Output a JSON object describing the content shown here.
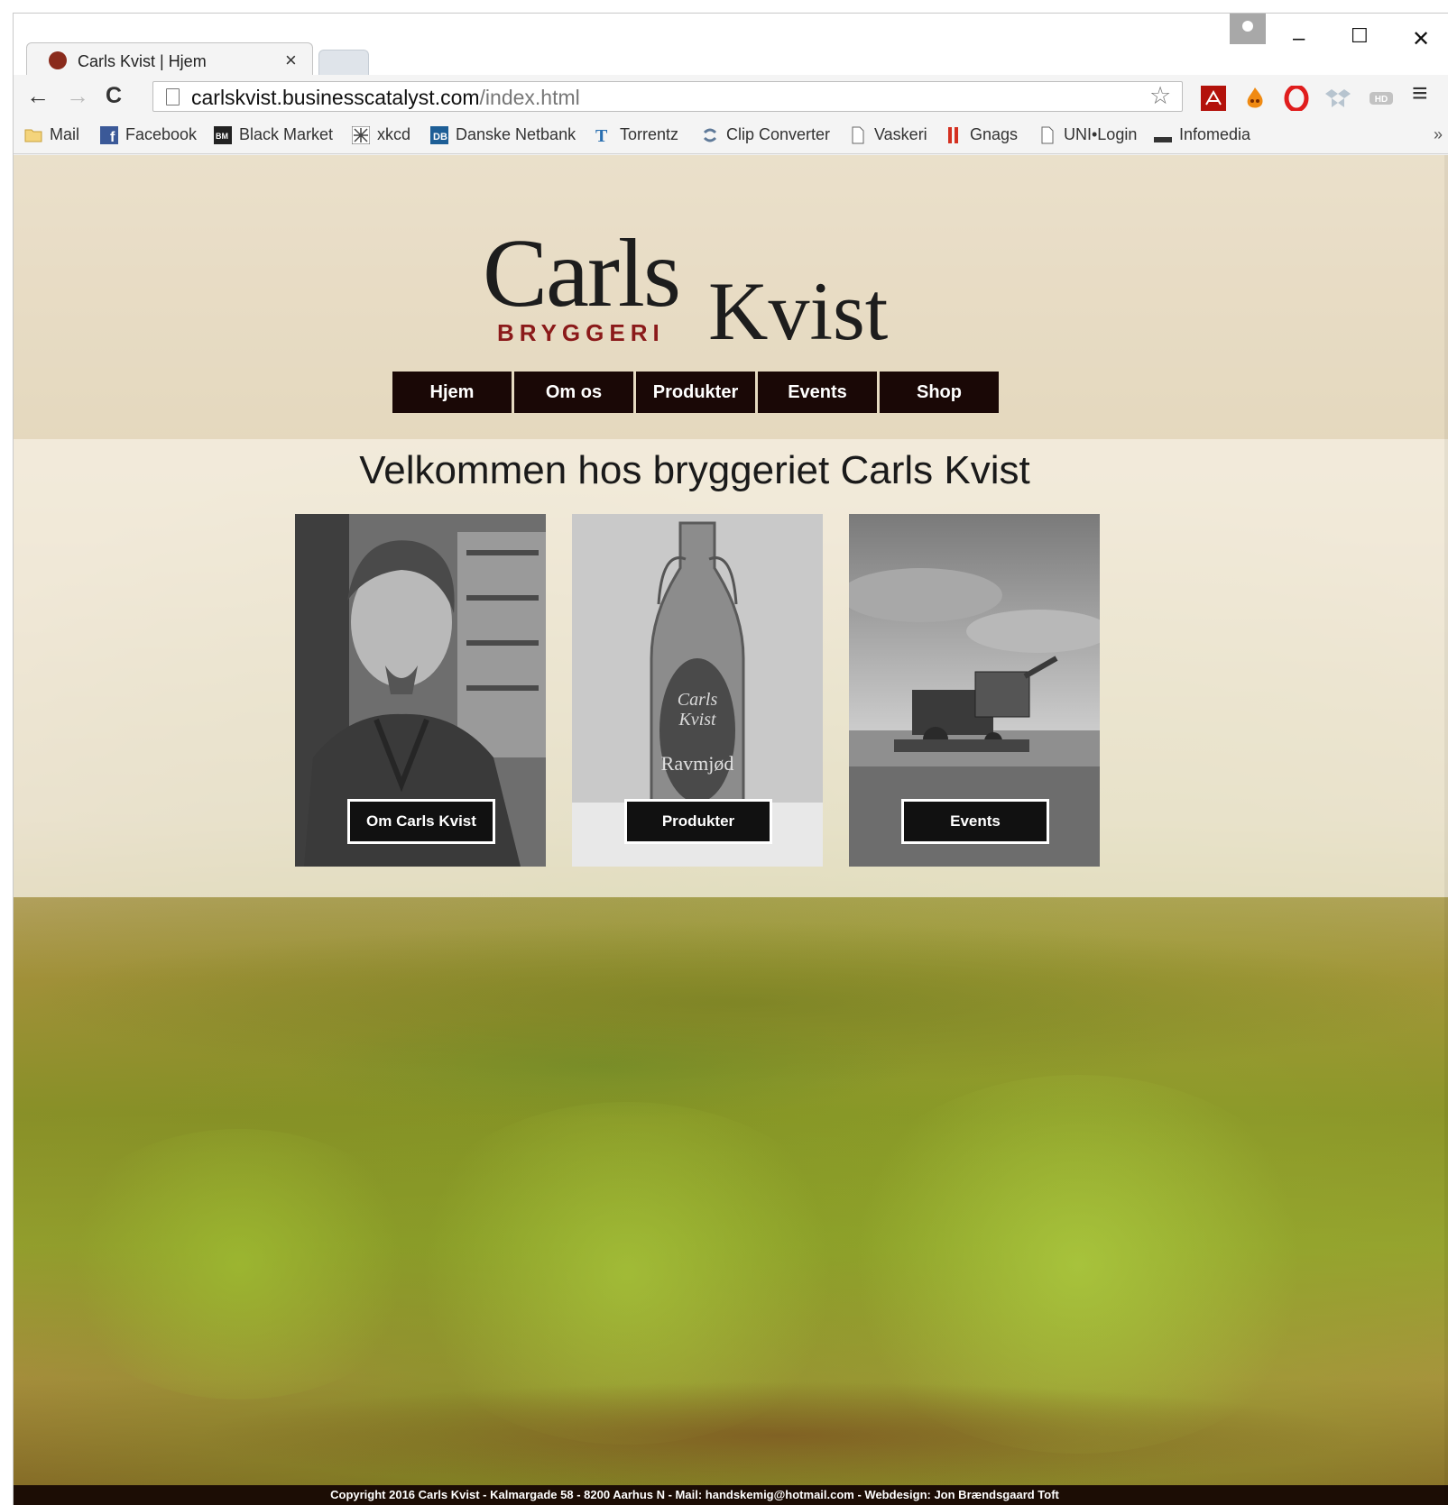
{
  "browser": {
    "tab": {
      "title": "Carls Kvist | Hjem",
      "close": "×"
    },
    "window_controls": {
      "minimize": "–",
      "maximize": "☐",
      "close": "✕"
    },
    "toolbar": {
      "back": "←",
      "forward": "→",
      "reload": "C",
      "url_host": "carlskvist.businesscatalyst.com",
      "url_path": "/index.html",
      "star": "☆",
      "menu": "≡"
    },
    "bookmarks": [
      {
        "label": "Mail",
        "icon": "folder-icon",
        "color": "#e2b04a"
      },
      {
        "label": "Facebook",
        "icon": "facebook-icon",
        "color": "#3b5998"
      },
      {
        "label": "Black Market",
        "icon": "black-market-icon",
        "color": "#222222"
      },
      {
        "label": "xkcd",
        "icon": "xkcd-icon",
        "color": "#555555"
      },
      {
        "label": "Danske Netbank",
        "icon": "danske-icon",
        "color": "#1d5e96"
      },
      {
        "label": "Torrentz",
        "icon": "torrentz-icon",
        "color": "#2a6fb0"
      },
      {
        "label": "Clip Converter",
        "icon": "clip-converter-icon",
        "color": "#5f7a99"
      },
      {
        "label": "Vaskeri",
        "icon": "page-icon",
        "color": "#777777"
      },
      {
        "label": "Gnags",
        "icon": "gnags-icon",
        "color": "#d43020"
      },
      {
        "label": "UNI•Login",
        "icon": "page-icon",
        "color": "#777777"
      },
      {
        "label": "Infomedia",
        "icon": "infomedia-icon",
        "color": "#333333"
      }
    ],
    "bookmarks_more": "»"
  },
  "site": {
    "logo": {
      "carls": "Carls",
      "kvist": "Kvist",
      "bryggeri": "BRYGGERI"
    },
    "nav": [
      "Hjem",
      "Om os",
      "Produkter",
      "Events",
      "Shop"
    ],
    "welcome": "Velkommen hos bryggeriet Carls Kvist",
    "cards": [
      {
        "button": "Om Carls Kvist"
      },
      {
        "button": "Produkter",
        "bottle_label_1": "Carls",
        "bottle_label_2": "Kvist",
        "bottle_label_3": "Ravmjød"
      },
      {
        "button": "Events"
      }
    ],
    "footer": "Copyright 2016 Carls Kvist - Kalmargade 58 - 8200 Aarhus N - Mail: handskemig@hotmail.com - Webdesign: Jon Brændsgaard Toft"
  }
}
